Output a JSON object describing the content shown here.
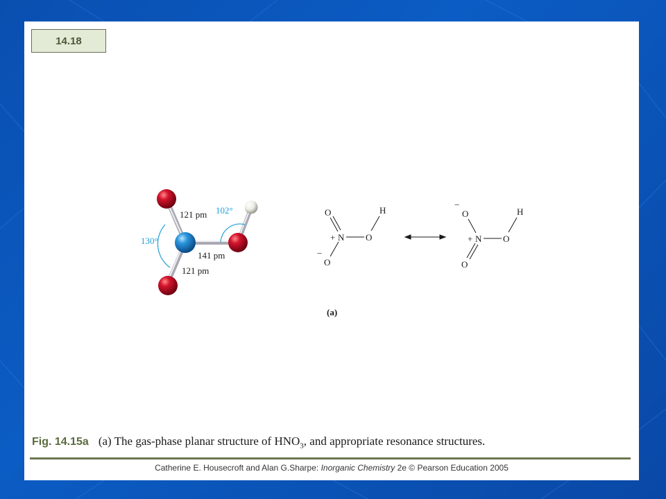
{
  "slide": {
    "number": "14.18"
  },
  "model": {
    "bond_label_top": "121 pm",
    "bond_label_middle": "141 pm",
    "bond_label_bottom": "121 pm",
    "angle_left": "130°",
    "angle_right": "102°",
    "colors": {
      "nitrogen": "#1f8fd6",
      "oxygen": "#c8102e",
      "hydrogen": "#f2f2ee",
      "angle_arc": "#1ea0d8",
      "bond": "#c9c9cf"
    }
  },
  "resonance_left": {
    "o_top": "O",
    "n": "N",
    "plus": "+",
    "o_right": "O",
    "h": "H",
    "minus": "−",
    "o_bottom": "O"
  },
  "resonance_right": {
    "minus": "−",
    "o_top": "O",
    "h": "H",
    "plus": "+",
    "n": "N",
    "o_right": "O",
    "o_bottom": "O"
  },
  "panel_label": "(a)",
  "caption": {
    "label": "Fig. 14.15a",
    "text_before": "(a) The gas-phase planar structure of HNO",
    "subscript": "3",
    "text_after": ", and appropriate resonance structures."
  },
  "credit": {
    "authors": "Catherine E. Housecroft and Alan G.Sharpe: ",
    "title": "Inorganic Chemistry",
    "rest": " 2e © Pearson Education 2005"
  }
}
